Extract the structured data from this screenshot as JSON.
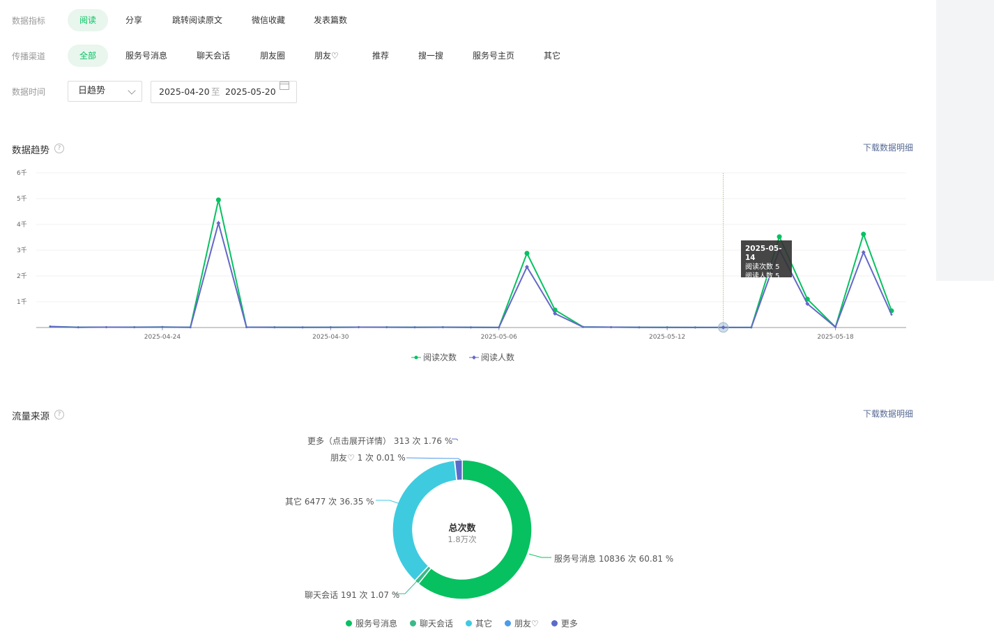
{
  "filters": {
    "metric": {
      "label": "数据指标",
      "options": [
        "阅读",
        "分享",
        "跳转阅读原文",
        "微信收藏",
        "发表篇数"
      ],
      "selected": "阅读"
    },
    "channel": {
      "label": "传播渠道",
      "options": [
        "全部",
        "服务号消息",
        "聊天会话",
        "朋友圈",
        "朋友♡",
        "推荐",
        "搜一搜",
        "服务号主页",
        "其它"
      ],
      "selected": "全部"
    },
    "time": {
      "label": "数据时间",
      "granularity": "日趋势",
      "start": "2025-04-20",
      "to": "至",
      "end": "2025-05-20"
    }
  },
  "trend": {
    "title": "数据趋势",
    "download": "下载数据明细",
    "tooltip": {
      "date": "2025-05-14",
      "rows": [
        "阅读次数 5",
        "阅读人数 5"
      ]
    }
  },
  "traffic": {
    "title": "流量来源",
    "download": "下载数据明细",
    "center_title": "总次数",
    "center_value": "1.8万次",
    "labels": {
      "more": "更多（点击展开详情） 313 次 1.76 %",
      "friend": "朋友♡ 1 次 0.01 %",
      "other": "其它 6477 次 36.35 %",
      "service": "服务号消息 10836 次 60.81 %",
      "chat": "聊天会话 191 次 1.07 %"
    },
    "legend": [
      "服务号消息",
      "聊天会话",
      "其它",
      "朋友♡",
      "更多"
    ]
  },
  "colors": {
    "green": "#07c160",
    "purple_blue": "#6467c7",
    "chat": "#3cb98a",
    "other": "#3ecbe0",
    "friend": "#4a9be8",
    "more": "#5b6bc9"
  },
  "chart_data": [
    {
      "type": "line",
      "x": [
        "2025-04-20",
        "2025-04-21",
        "2025-04-22",
        "2025-04-23",
        "2025-04-24",
        "2025-04-25",
        "2025-04-26",
        "2025-04-27",
        "2025-04-28",
        "2025-04-29",
        "2025-04-30",
        "2025-05-01",
        "2025-05-02",
        "2025-05-03",
        "2025-05-04",
        "2025-05-05",
        "2025-05-06",
        "2025-05-07",
        "2025-05-08",
        "2025-05-09",
        "2025-05-10",
        "2025-05-11",
        "2025-05-12",
        "2025-05-13",
        "2025-05-14",
        "2025-05-15",
        "2025-05-16",
        "2025-05-17",
        "2025-05-18",
        "2025-05-19",
        "2025-05-20"
      ],
      "x_ticks": [
        "2025-04-24",
        "2025-04-30",
        "2025-05-06",
        "2025-05-12",
        "2025-05-18"
      ],
      "y_ticks": [
        "1千",
        "2千",
        "3千",
        "4千",
        "5千",
        "6千"
      ],
      "ylim": [
        0,
        6000
      ],
      "series": [
        {
          "name": "阅读次数",
          "values": [
            40,
            10,
            15,
            12,
            20,
            10,
            4950,
            12,
            10,
            8,
            10,
            15,
            12,
            10,
            14,
            8,
            5,
            2880,
            680,
            25,
            15,
            8,
            6,
            4,
            5,
            5,
            3520,
            1100,
            20,
            3620,
            650
          ]
        },
        {
          "name": "阅读人数",
          "values": [
            35,
            8,
            12,
            10,
            15,
            8,
            4050,
            10,
            8,
            6,
            8,
            12,
            10,
            8,
            10,
            6,
            4,
            2350,
            540,
            20,
            12,
            6,
            5,
            3,
            5,
            4,
            3020,
            920,
            15,
            2920,
            500
          ]
        }
      ]
    },
    {
      "type": "pie",
      "categories": [
        "服务号消息",
        "聊天会话",
        "其它",
        "朋友♡",
        "更多"
      ],
      "values": [
        10836,
        191,
        6477,
        1,
        313
      ],
      "percent": [
        60.81,
        1.07,
        36.35,
        0.01,
        1.76
      ]
    }
  ]
}
